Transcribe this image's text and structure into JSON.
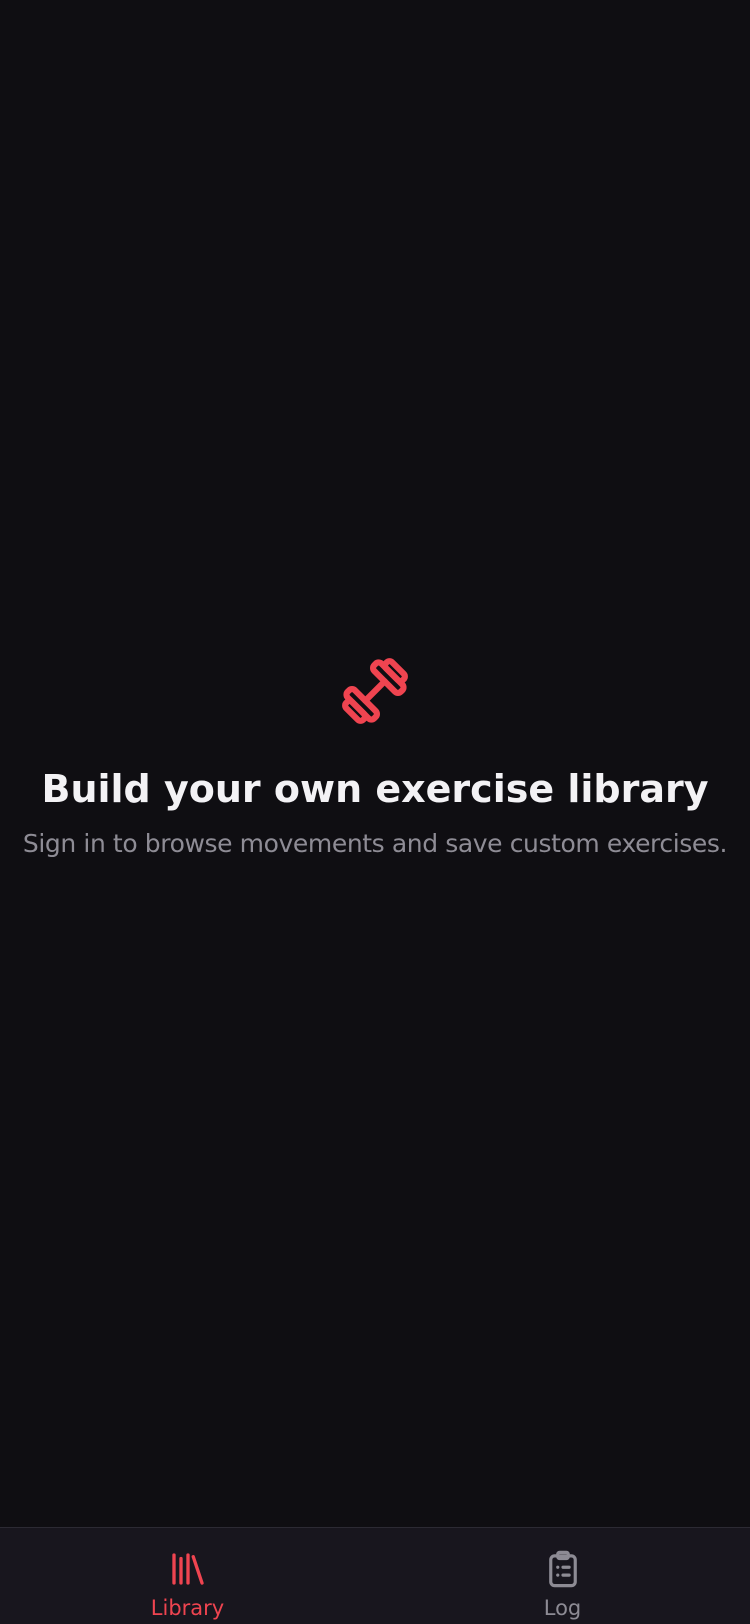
{
  "colors": {
    "background": "#0f0e12",
    "accent": "#ef4450",
    "title": "#f3f2f5",
    "subtitle": "#8e8c95",
    "tab_bar": "#18161e",
    "tab_inactive": "#8d8b94"
  },
  "empty_state": {
    "icon": "barbell-icon",
    "title": "Build your own exercise library",
    "subtitle": "Sign in to browse movements and save custom exercises."
  },
  "tab_bar": {
    "tabs": [
      {
        "label": "Library",
        "icon": "library-icon",
        "active": true
      },
      {
        "label": "Log",
        "icon": "clipboard-list-icon",
        "active": false
      }
    ]
  }
}
